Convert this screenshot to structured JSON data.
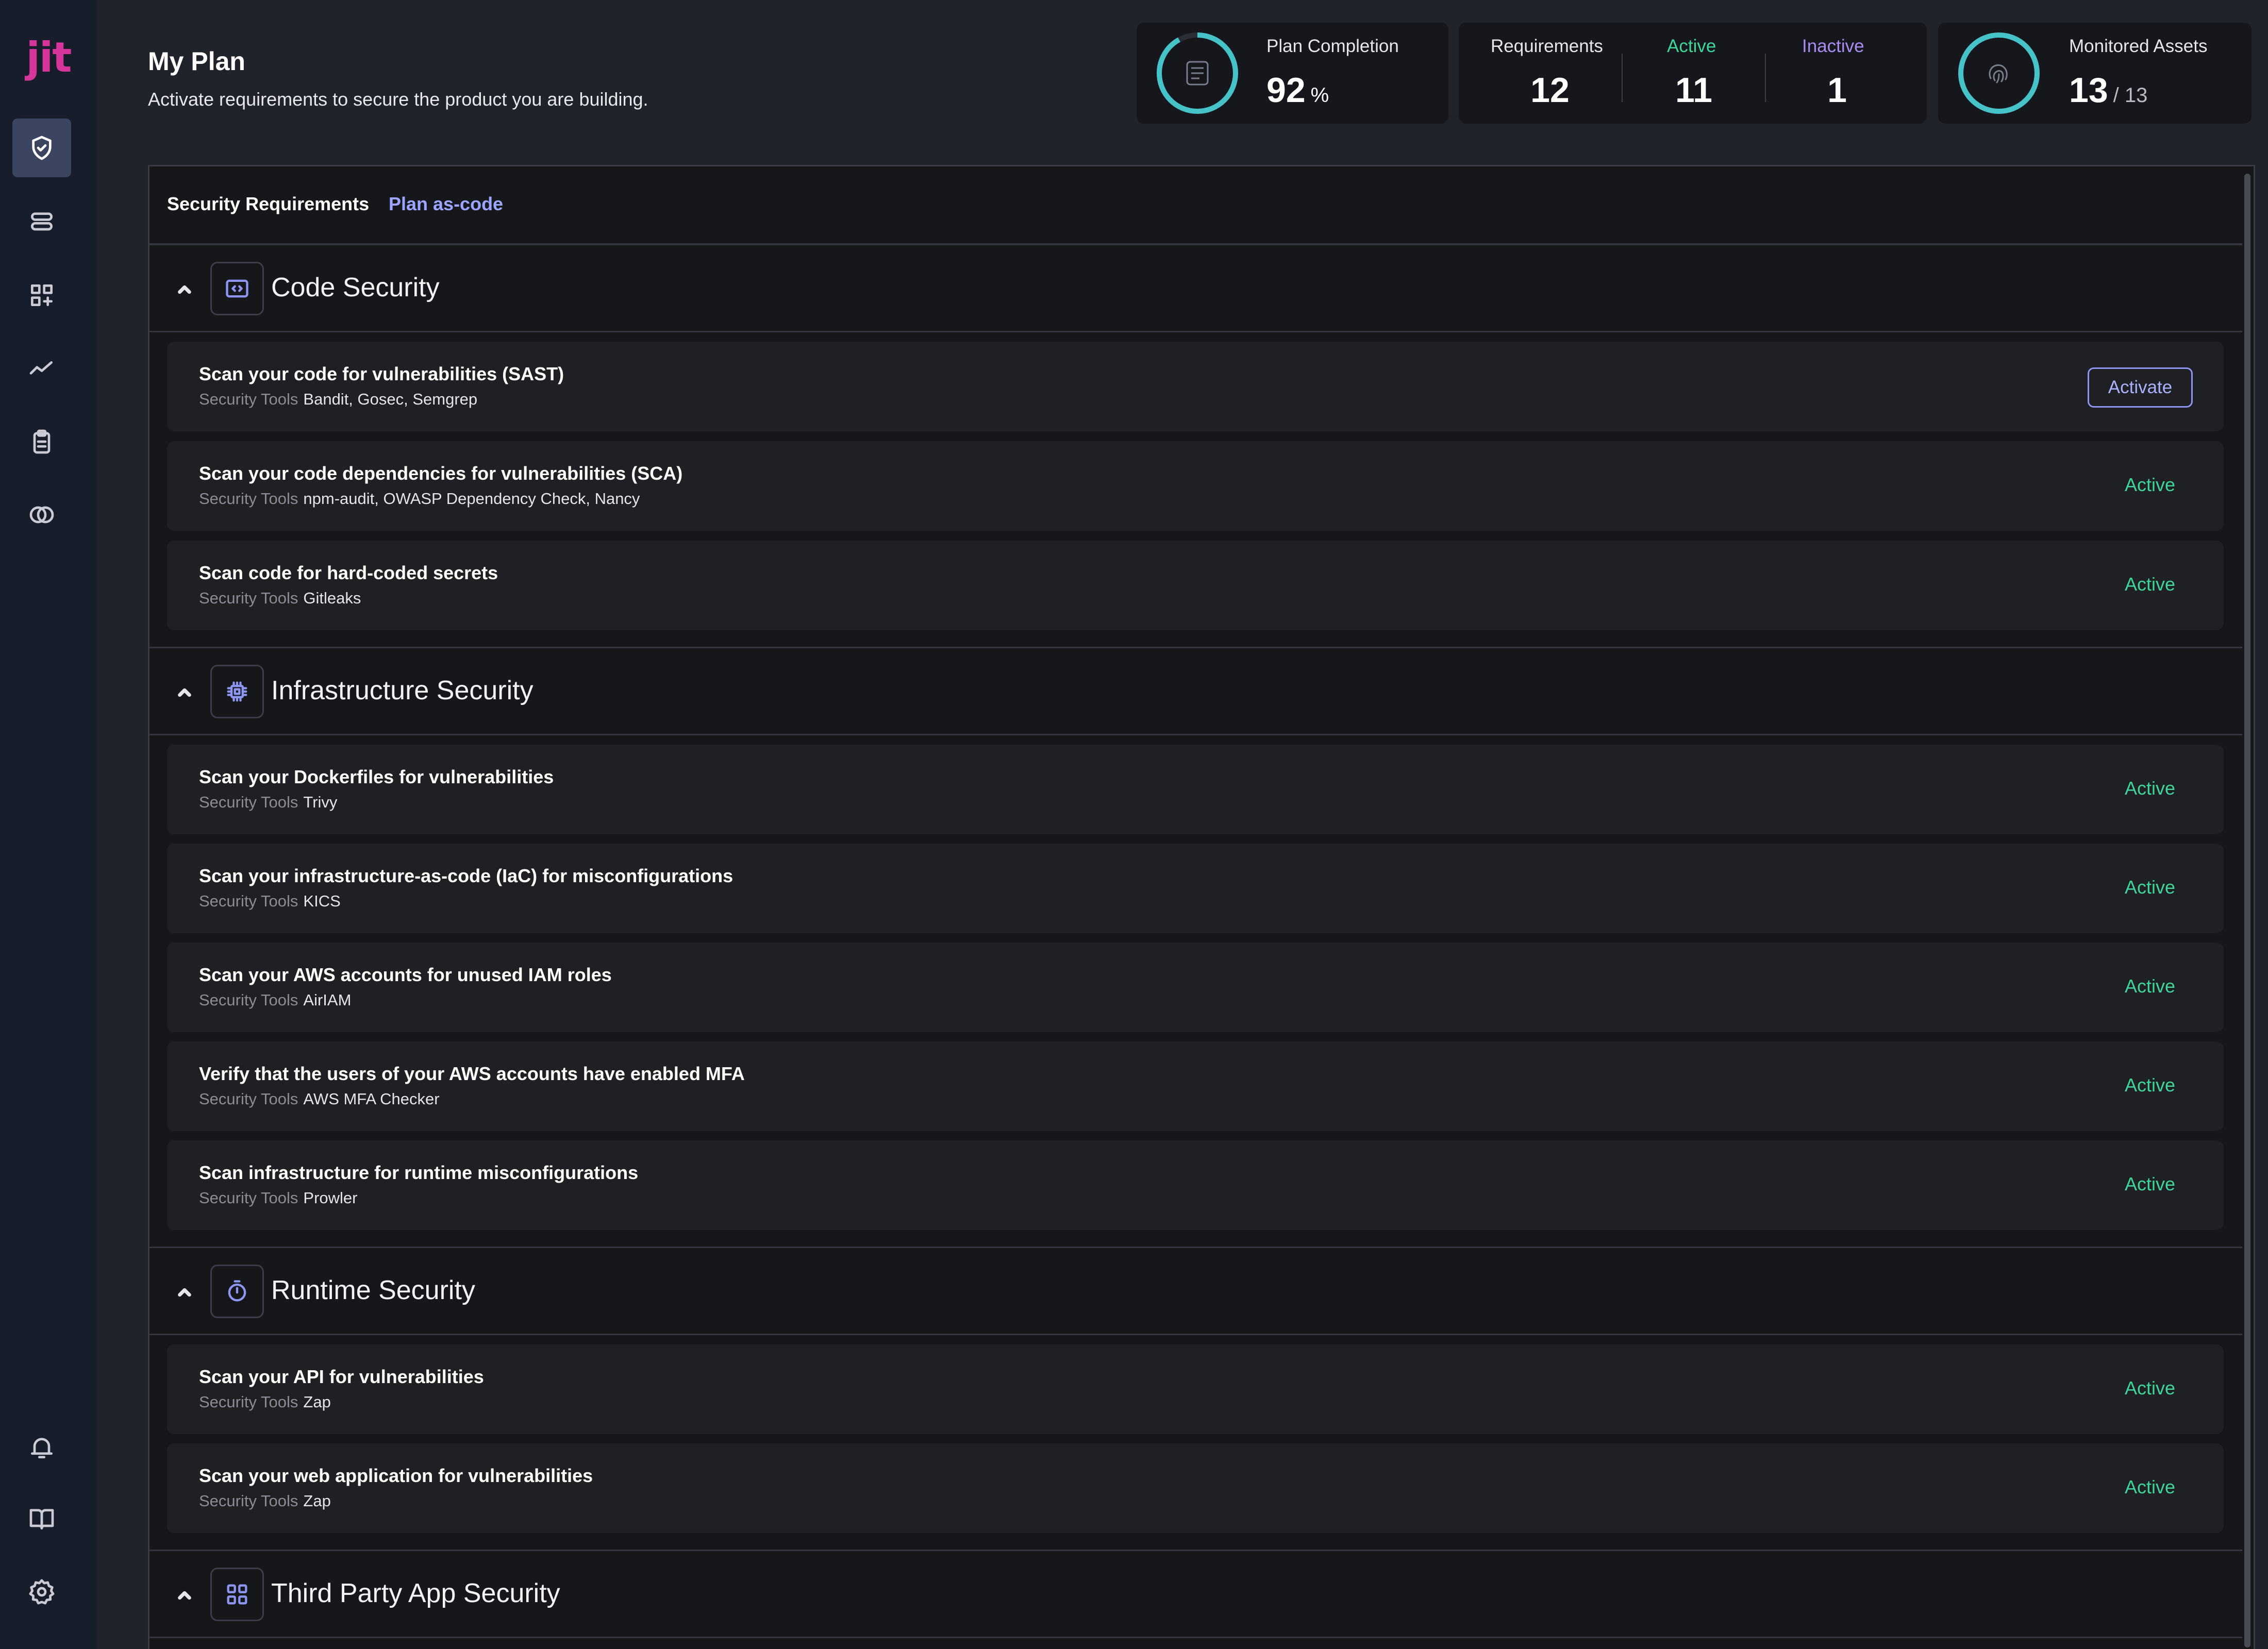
{
  "brand": {
    "logo_text": "jit",
    "logo_color": "#d6369c"
  },
  "header": {
    "title": "My Plan",
    "subtitle": "Activate requirements to secure the product you are building."
  },
  "stats": {
    "plan_completion": {
      "label": "Plan Completion",
      "value": "92",
      "unit": "%",
      "progress_fraction": 0.92
    },
    "requirements": {
      "label": "Requirements",
      "value": "12"
    },
    "active": {
      "label": "Active",
      "value": "11",
      "color": "#3ed49a"
    },
    "inactive": {
      "label": "Inactive",
      "value": "1",
      "color": "#a88df0"
    },
    "monitored_assets": {
      "label": "Monitored Assets",
      "value": "13",
      "total": "/ 13",
      "progress_fraction": 1.0
    }
  },
  "sidebar": {
    "items": [
      {
        "icon": "shield-check-icon",
        "active": true
      },
      {
        "icon": "layers-icon",
        "active": false
      },
      {
        "icon": "grid-plus-icon",
        "active": false
      },
      {
        "icon": "trend-line-icon",
        "active": false
      },
      {
        "icon": "clipboard-icon",
        "active": false
      },
      {
        "icon": "rings-icon",
        "active": false
      },
      {
        "icon": "bell-icon",
        "active": false
      },
      {
        "icon": "book-icon",
        "active": false
      },
      {
        "icon": "gear-icon",
        "active": false
      }
    ]
  },
  "tabs": {
    "security_requirements": "Security Requirements",
    "plan_as_code": "Plan as-code"
  },
  "tools_label": "Security Tools",
  "sections": [
    {
      "title": "Code Security",
      "icon": "code-icon",
      "requirements": [
        {
          "title": "Scan your code for vulnerabilities (SAST)",
          "tools": "Bandit, Gosec, Semgrep",
          "status": "Activate"
        },
        {
          "title": "Scan your code dependencies for vulnerabilities (SCA)",
          "tools": "npm-audit, OWASP Dependency Check, Nancy",
          "status": "Active"
        },
        {
          "title": "Scan code for hard-coded secrets",
          "tools": "Gitleaks",
          "status": "Active"
        }
      ]
    },
    {
      "title": "Infrastructure Security",
      "icon": "cpu-chip-icon",
      "requirements": [
        {
          "title": "Scan your Dockerfiles for vulnerabilities",
          "tools": "Trivy",
          "status": "Active"
        },
        {
          "title": "Scan your infrastructure-as-code (IaC) for misconfigurations",
          "tools": "KICS",
          "status": "Active"
        },
        {
          "title": "Scan your AWS accounts for unused IAM roles",
          "tools": "AirIAM",
          "status": "Active"
        },
        {
          "title": "Verify that the users of your AWS accounts have enabled MFA",
          "tools": "AWS MFA Checker",
          "status": "Active"
        },
        {
          "title": "Scan infrastructure for runtime misconfigurations",
          "tools": "Prowler",
          "status": "Active"
        }
      ]
    },
    {
      "title": "Runtime Security",
      "icon": "stopwatch-icon",
      "requirements": [
        {
          "title": "Scan your API for vulnerabilities",
          "tools": "Zap",
          "status": "Active"
        },
        {
          "title": "Scan your web application for vulnerabilities",
          "tools": "Zap",
          "status": "Active"
        }
      ]
    },
    {
      "title": "Third Party App Security",
      "icon": "apps-grid-icon",
      "requirements": []
    }
  ]
}
